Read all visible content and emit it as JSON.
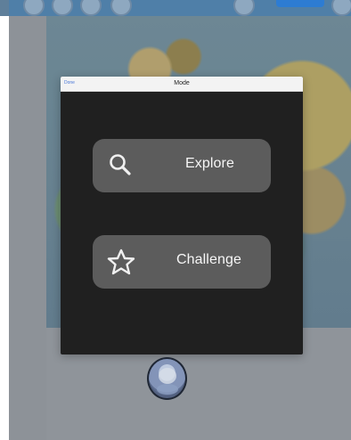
{
  "modal": {
    "cancel_label": "Done",
    "title": "Mode"
  },
  "buttons": {
    "explore": {
      "label": "Explore",
      "icon": "search-icon"
    },
    "challenge": {
      "label": "Challenge",
      "icon": "star-icon"
    }
  },
  "colors": {
    "background": "#8d9298",
    "topbar": "#4f7fa8",
    "modal": "#202020",
    "button": "#5c5c5c",
    "accent": "#2d7cd3"
  }
}
